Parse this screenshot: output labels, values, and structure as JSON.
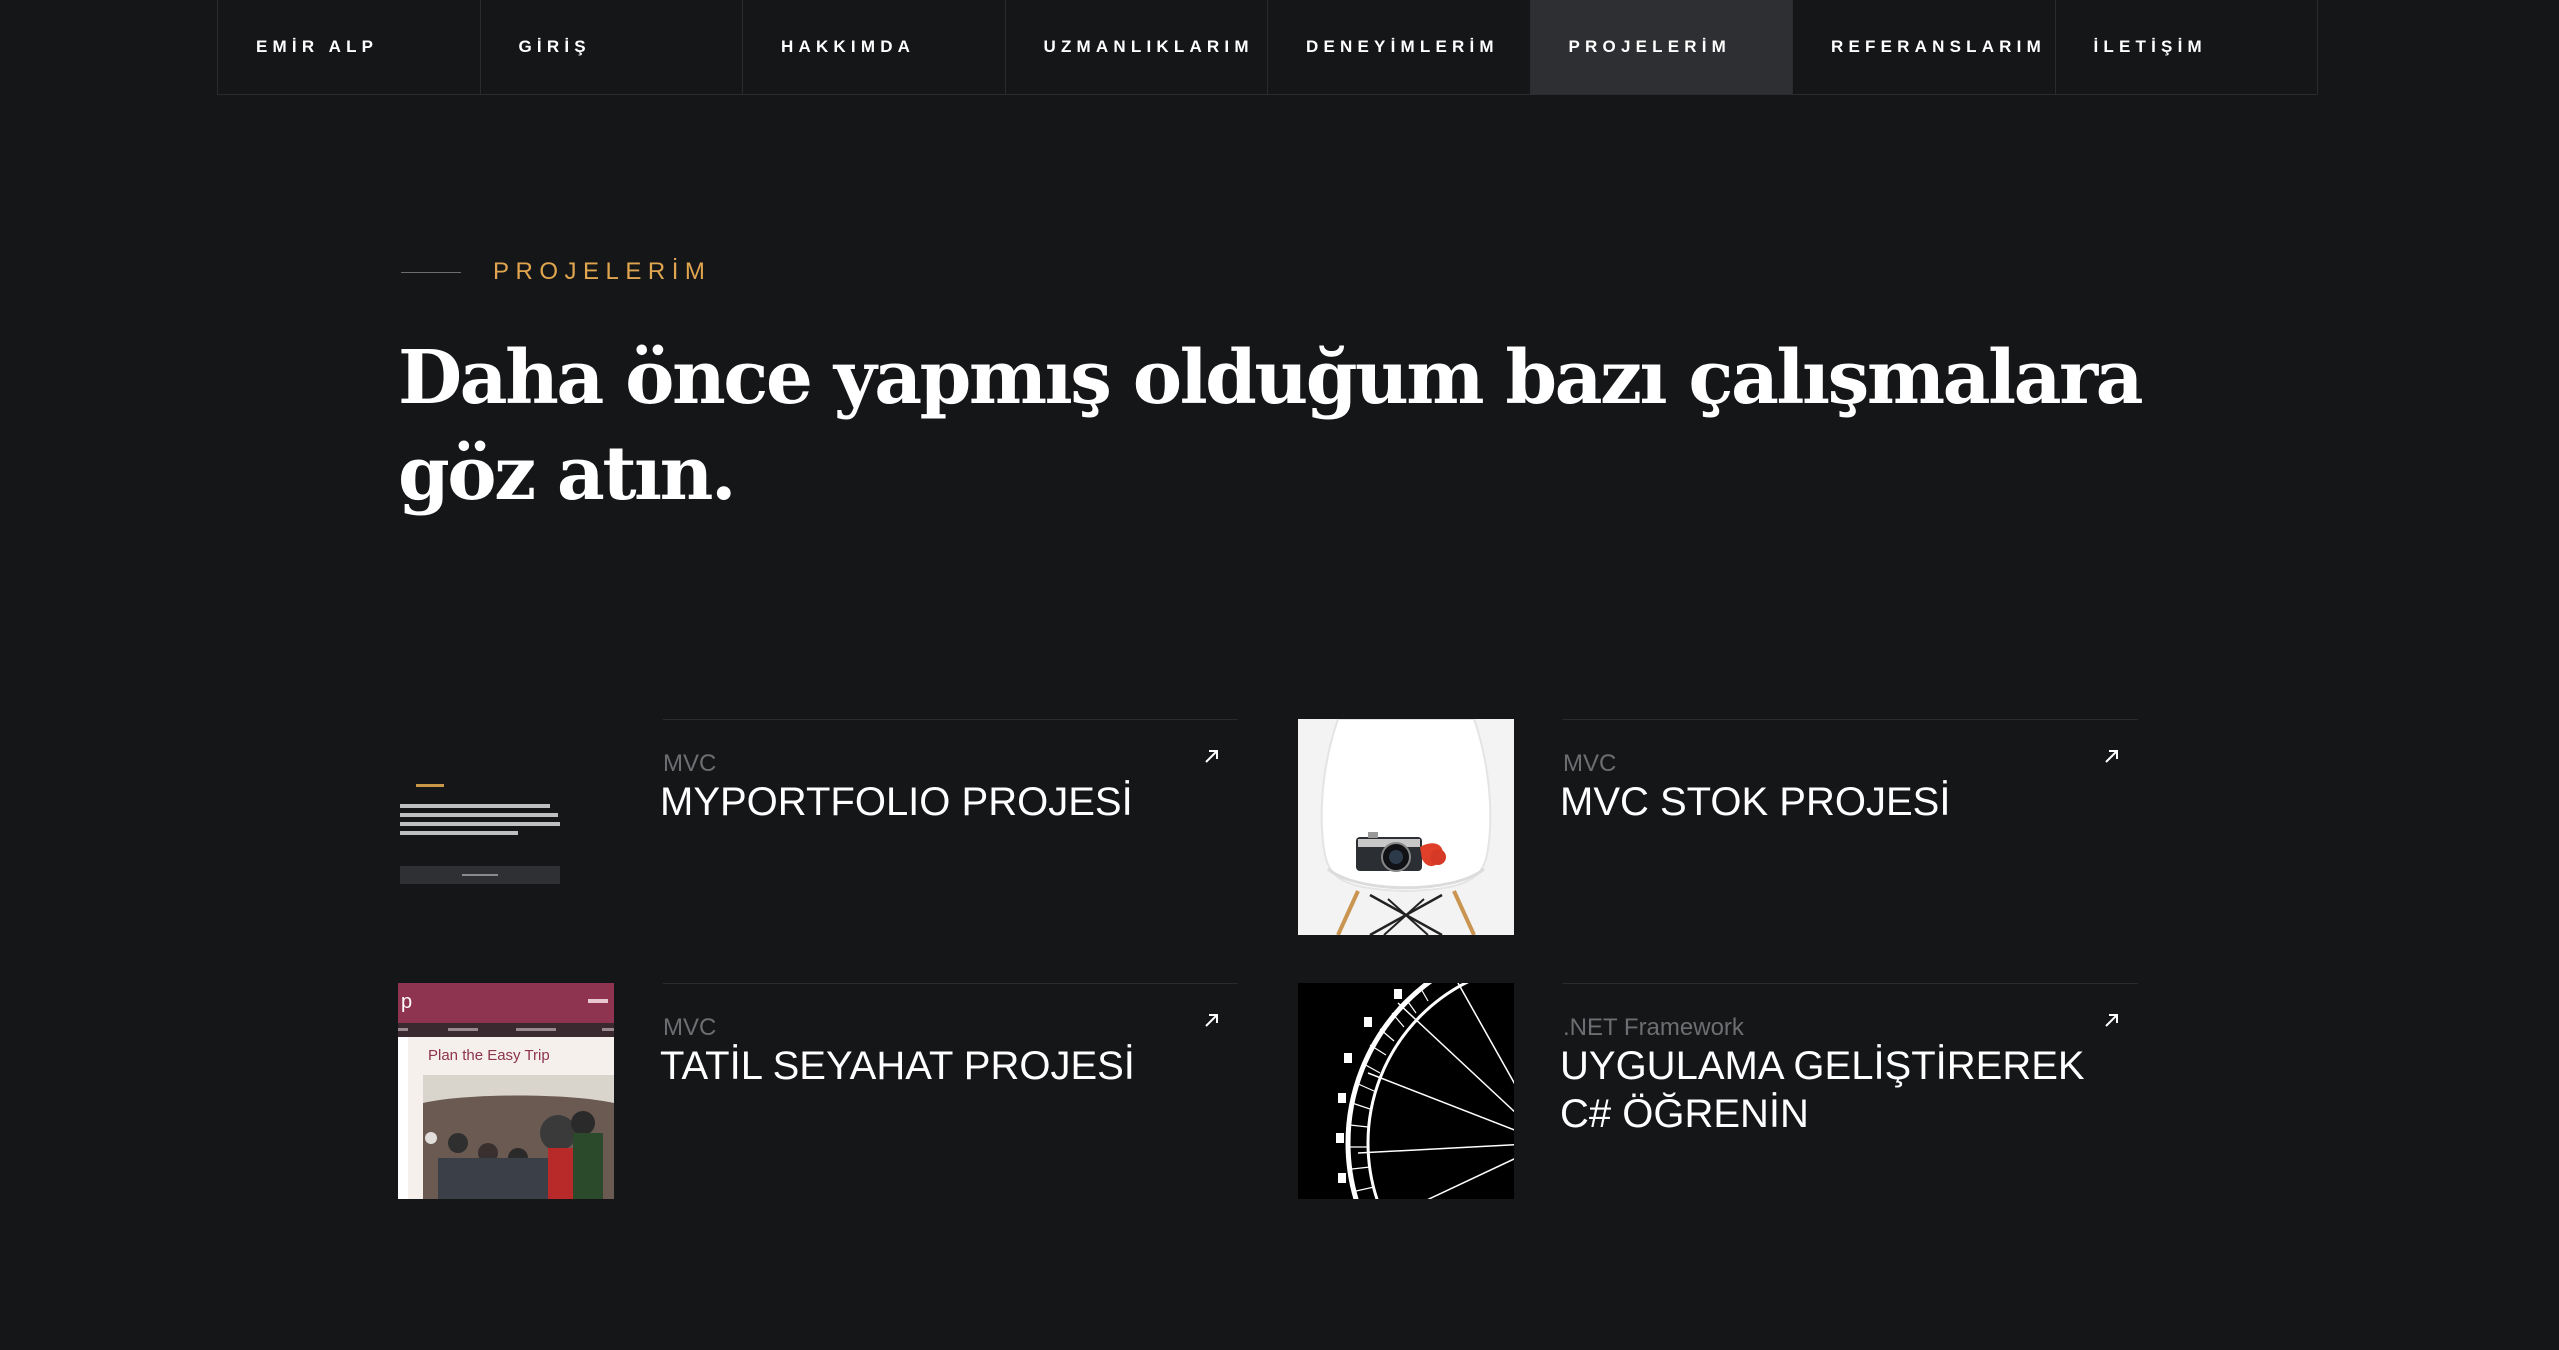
{
  "nav": {
    "items": [
      {
        "label": "EMİR ALP",
        "active": false
      },
      {
        "label": "GİRİŞ",
        "active": false
      },
      {
        "label": "HAKKIMDA",
        "active": false
      },
      {
        "label": "UZMANLIKLARIM",
        "active": false
      },
      {
        "label": "DENEYİMLERİM",
        "active": false
      },
      {
        "label": "PROJELERİM",
        "active": true
      },
      {
        "label": "REFERANSLARIM",
        "active": false
      },
      {
        "label": "İLETİŞİM",
        "active": false
      }
    ]
  },
  "section": {
    "eyebrow": "PROJELERİM",
    "headline_line1": "Daha önce yapmış olduğum bazı çalışmalara",
    "headline_line2": "göz atın."
  },
  "projects": [
    {
      "category": "MVC",
      "title": "MYPORTFOLIO PROJESİ",
      "image": "portfolio-screenshot",
      "link_icon": "external-link-arrow-icon"
    },
    {
      "category": "MVC",
      "title": "MVC STOK PROJESİ",
      "image": "camera-on-chair-photo",
      "link_icon": "external-link-arrow-icon"
    },
    {
      "category": "MVC",
      "title": "TATİL SEYAHAT PROJESİ",
      "image": "travel-site-screenshot",
      "thumb_text": "Plan the Easy Trip",
      "link_icon": "external-link-arrow-icon"
    },
    {
      "category": ".NET Framework",
      "title": "UYGULAMA GELİŞTİREREK C# ÖĞRENİN",
      "image": "ferris-wheel-photo",
      "link_icon": "external-link-arrow-icon"
    }
  ],
  "colors": {
    "background": "#151618",
    "accent": "#e0a54f",
    "nav_active": "#2e2f32",
    "muted": "#6d6e71"
  }
}
